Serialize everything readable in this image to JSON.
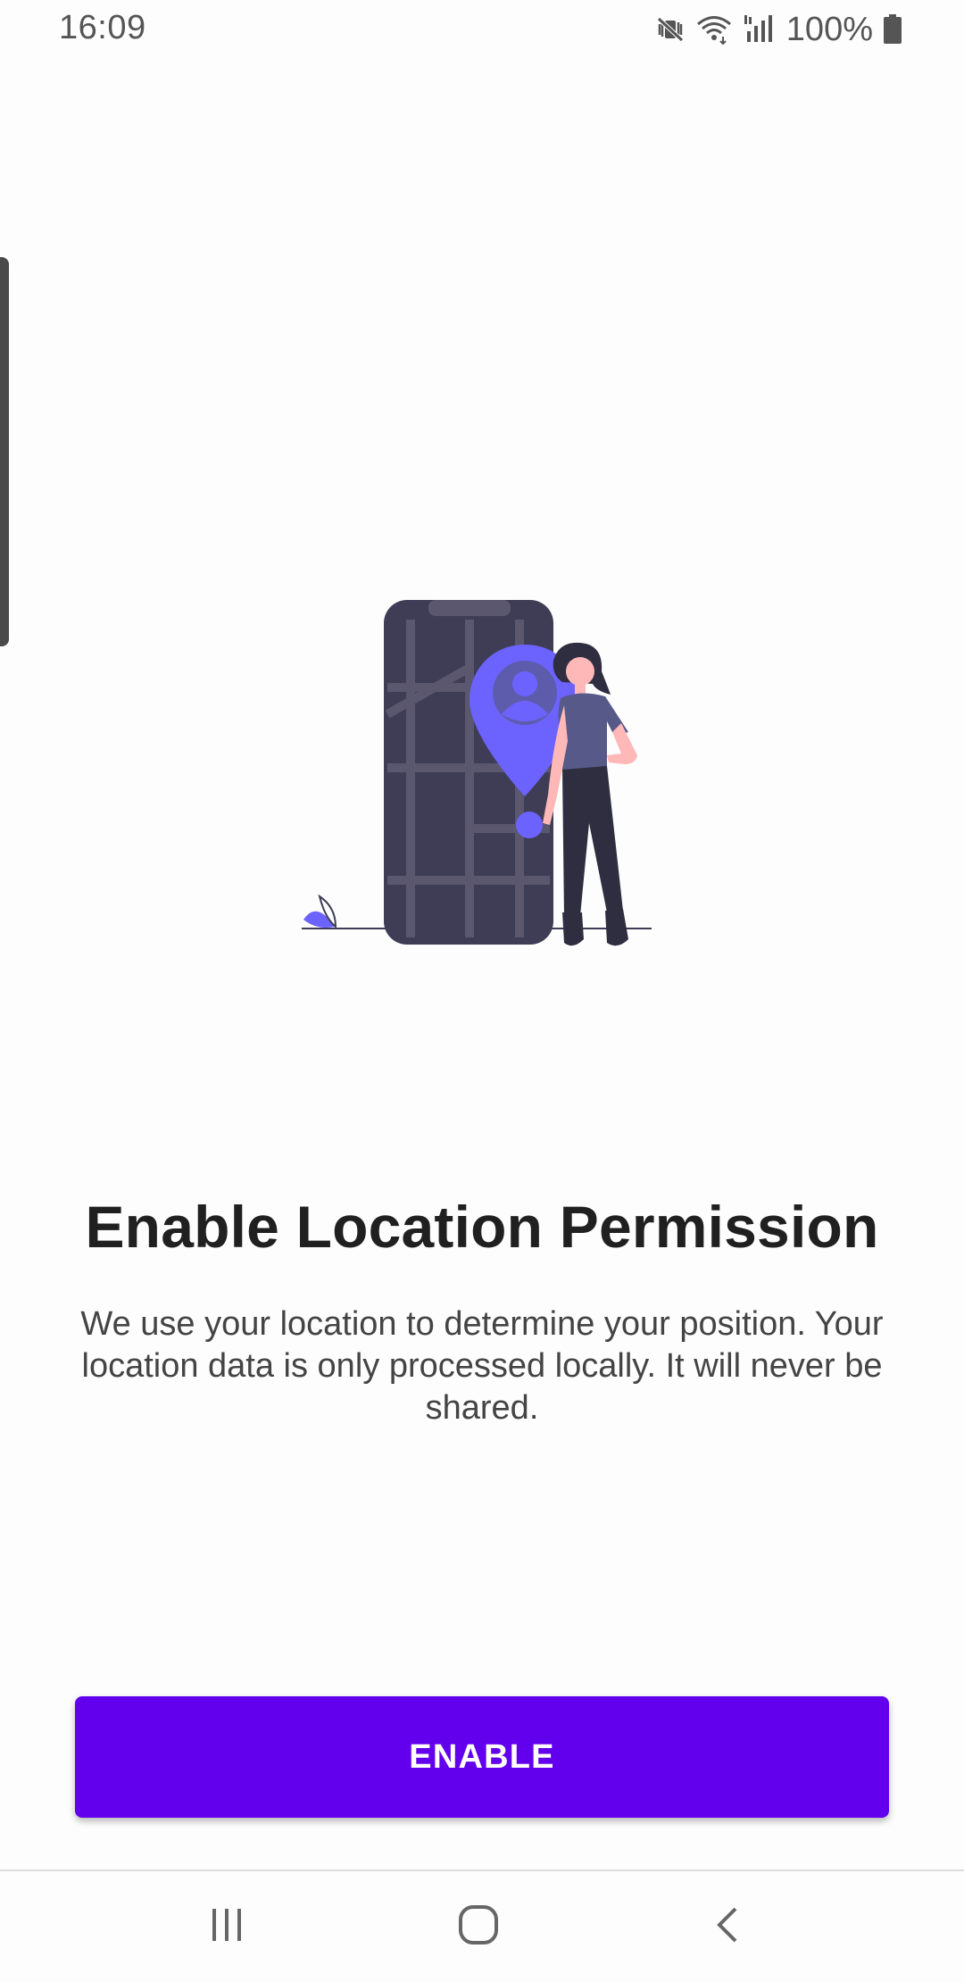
{
  "status_bar": {
    "time": "16:09",
    "battery": "100%",
    "icons": [
      "mute-vibrate-icon",
      "wifi-icon",
      "signal-icon",
      "battery-icon"
    ]
  },
  "illustration": {
    "name": "phone-map-with-location-pin-and-woman",
    "colors": {
      "phone": "#3f3d56",
      "map_lines": "#5a576e",
      "pin": "#6c63ff",
      "shirt": "#575a89",
      "pants": "#2f2e41",
      "skin": "#ffb8b8",
      "hair": "#2f2e41"
    }
  },
  "content": {
    "title": "Enable Location Permission",
    "description": "We use your location to determine your position. Your location data is only processed locally. It will never be shared."
  },
  "actions": {
    "enable_label": "ENABLE"
  },
  "nav_bar": {
    "icons": [
      "recent-apps-icon",
      "home-icon",
      "back-icon"
    ]
  },
  "colors": {
    "accent": "#6200ee",
    "background": "#fdfdfd",
    "title_text": "#202020",
    "body_text": "#444444"
  }
}
